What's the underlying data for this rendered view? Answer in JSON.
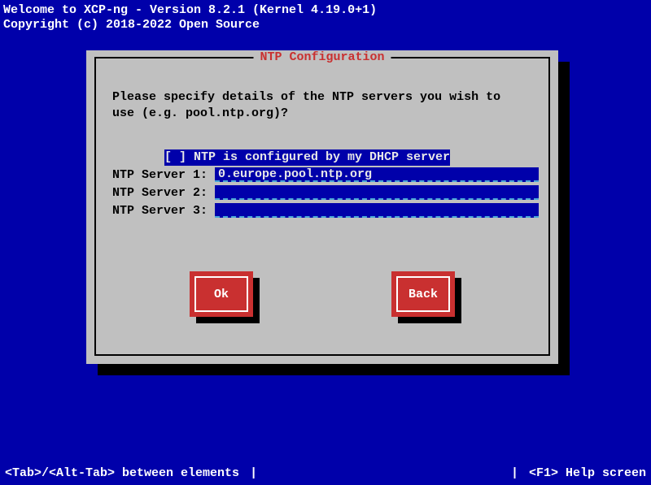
{
  "header": {
    "line1": "Welcome to XCP-ng - Version 8.2.1 (Kernel 4.19.0+1)",
    "line2": "Copyright (c) 2018-2022 Open Source"
  },
  "dialog": {
    "title": "NTP Configuration",
    "message_l1": "Please specify details of the NTP servers you wish to",
    "message_l2": "use (e.g. pool.ntp.org)?",
    "dhcp_option": "[ ] NTP is configured by my DHCP server",
    "rows": [
      {
        "label": "NTP Server 1: ",
        "value": "0.europe.pool.ntp.org"
      },
      {
        "label": "NTP Server 2: ",
        "value": ""
      },
      {
        "label": "NTP Server 3: ",
        "value": ""
      }
    ],
    "ok": "Ok",
    "back": "Back"
  },
  "footer": {
    "left": "<Tab>/<Alt-Tab> between elements",
    "right": "<F1> Help screen",
    "sep": "|"
  },
  "colors": {
    "bg": "#0000aa",
    "panel": "#c0c0c0",
    "accent": "#c93030"
  }
}
